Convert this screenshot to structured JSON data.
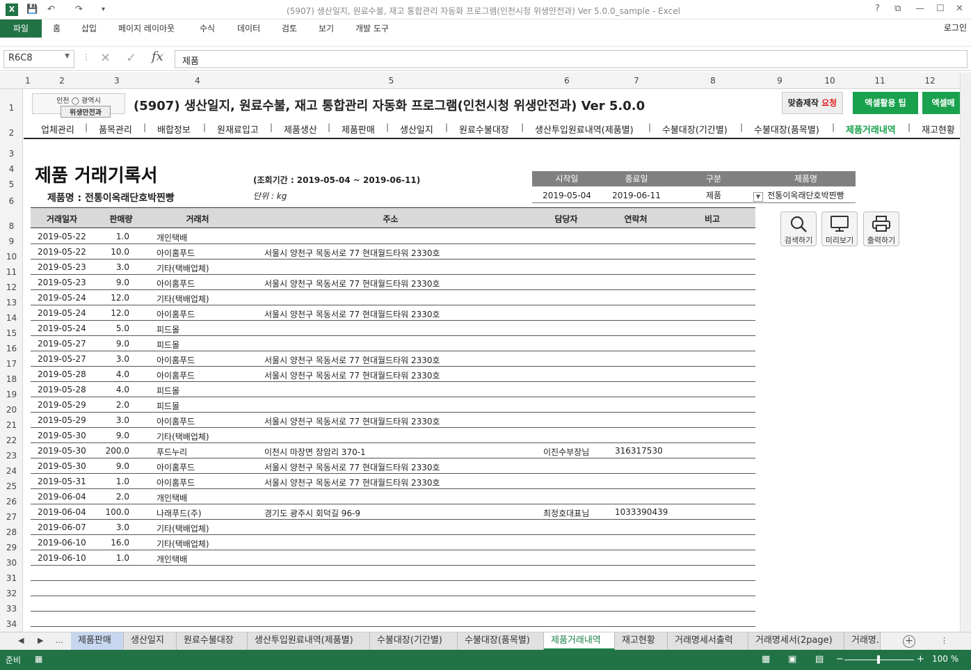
{
  "window": {
    "title": "(5907) 생산일지, 원료수불, 재고 통합관리 자동화 프로그램(인천시청 위생안전과) Ver 5.0.0_sample - Excel",
    "app_icon": "X",
    "controls": [
      "?",
      "⧉",
      "—",
      "☐",
      "✕"
    ]
  },
  "ribbon": {
    "tabs": [
      "파일",
      "홈",
      "삽입",
      "페이지 레이아웃",
      "수식",
      "데이터",
      "검토",
      "보기",
      "개발 도구"
    ],
    "login": "로그인"
  },
  "formula_bar": {
    "name_box": "R6C8",
    "fx": "fx",
    "value": "제품"
  },
  "columns": [
    "1",
    "2",
    "3",
    "4",
    "5",
    "6",
    "7",
    "8",
    "9",
    "10",
    "11",
    "12"
  ],
  "rows": [
    "1",
    "2",
    "3",
    "4",
    "5",
    "6",
    "",
    "8",
    "9",
    "10",
    "11",
    "12",
    "13",
    "14",
    "15",
    "16",
    "17",
    "18",
    "19",
    "20",
    "21",
    "22",
    "23",
    "24",
    "25",
    "26",
    "27",
    "28",
    "29",
    "30",
    "31",
    "32",
    "33",
    "34"
  ],
  "banner": {
    "logo_top": "인천 ◯ 광역시",
    "logo_sub": "위생안전과",
    "title": "(5907) 생산일지, 원료수불, 재고 통합관리 자동화 프로그램(인천시청 위생안전과) Ver 5.0.0",
    "request_btn_prefix": "맞춤제작",
    "request_btn_suffix": "요청",
    "tips_btn": "엑셀활용 팁",
    "extra_btn": "엑셀메"
  },
  "menu": [
    {
      "label": "업체관리"
    },
    {
      "label": "품목관리"
    },
    {
      "label": "배합정보"
    },
    {
      "label": "원재료입고"
    },
    {
      "label": "제품생산"
    },
    {
      "label": "제품판매"
    },
    {
      "label": "생산일지"
    },
    {
      "label": "원료수불대장"
    },
    {
      "label": "생산투입원료내역(제품별)"
    },
    {
      "label": "수불대장(기간별)"
    },
    {
      "label": "수불대장(품목별)"
    },
    {
      "label": "제품거래내역",
      "active": true
    },
    {
      "label": "재고현황"
    }
  ],
  "document": {
    "title": "제품 거래기록서",
    "product_line": "제품명 :  전통이옥래단호박찐빵",
    "period": "(조회기간 : 2019-05-04 ~ 2019-06-11)",
    "unit": "단위 : kg"
  },
  "filter": {
    "headers": [
      "시작일",
      "종료일",
      "구분",
      "제품명"
    ],
    "values": [
      "2019-05-04",
      "2019-06-11",
      "제품",
      "전통이옥래단호박찐빵"
    ]
  },
  "table": {
    "headers": [
      "거래일자",
      "판매량",
      "거래처",
      "주소",
      "담당자",
      "연락처",
      "비고"
    ],
    "rows": [
      [
        "2019-05-22",
        "1.0",
        "개인택배",
        "",
        "",
        "",
        ""
      ],
      [
        "2019-05-22",
        "10.0",
        "아이홈푸드",
        "서울시 양천구 목동서로 77 현대월드타워 2330호",
        "",
        "",
        ""
      ],
      [
        "2019-05-23",
        "3.0",
        "기타(택배업체)",
        "",
        "",
        "",
        ""
      ],
      [
        "2019-05-23",
        "9.0",
        "아이홈푸드",
        "서울시 양천구 목동서로 77 현대월드타워 2330호",
        "",
        "",
        ""
      ],
      [
        "2019-05-24",
        "12.0",
        "기타(택배업체)",
        "",
        "",
        "",
        ""
      ],
      [
        "2019-05-24",
        "12.0",
        "아이홈푸드",
        "서울시 양천구 목동서로 77 현대월드타워 2330호",
        "",
        "",
        ""
      ],
      [
        "2019-05-24",
        "5.0",
        "피드몰",
        "",
        "",
        "",
        ""
      ],
      [
        "2019-05-27",
        "9.0",
        "피드몰",
        "",
        "",
        "",
        ""
      ],
      [
        "2019-05-27",
        "3.0",
        "아이홈푸드",
        "서울시 양천구 목동서로 77 현대월드타워 2330호",
        "",
        "",
        ""
      ],
      [
        "2019-05-28",
        "4.0",
        "아이홈푸드",
        "서울시 양천구 목동서로 77 현대월드타워 2330호",
        "",
        "",
        ""
      ],
      [
        "2019-05-28",
        "4.0",
        "피드몰",
        "",
        "",
        "",
        ""
      ],
      [
        "2019-05-29",
        "2.0",
        "피드몰",
        "",
        "",
        "",
        ""
      ],
      [
        "2019-05-29",
        "3.0",
        "아이홈푸드",
        "서울시 양천구 목동서로 77 현대월드타워 2330호",
        "",
        "",
        ""
      ],
      [
        "2019-05-30",
        "9.0",
        "기타(택배업체)",
        "",
        "",
        "",
        ""
      ],
      [
        "2019-05-30",
        "200.0",
        "푸드누리",
        "이천시 마장면 장암리 370-1",
        "이진수부장님",
        "316317530",
        ""
      ],
      [
        "2019-05-30",
        "9.0",
        "아이홈푸드",
        "서울시 양천구 목동서로 77 현대월드타워 2330호",
        "",
        "",
        ""
      ],
      [
        "2019-05-31",
        "1.0",
        "아이홈푸드",
        "서울시 양천구 목동서로 77 현대월드타워 2330호",
        "",
        "",
        ""
      ],
      [
        "2019-06-04",
        "2.0",
        "개인택배",
        "",
        "",
        "",
        ""
      ],
      [
        "2019-06-04",
        "100.0",
        "나래푸드(주)",
        "경기도 광주시 회덕길 96-9",
        "최정호대표님",
        "1033390439",
        ""
      ],
      [
        "2019-06-07",
        "3.0",
        "기타(택배업체)",
        "",
        "",
        "",
        ""
      ],
      [
        "2019-06-10",
        "16.0",
        "기타(택배업체)",
        "",
        "",
        "",
        ""
      ],
      [
        "2019-06-10",
        "1.0",
        "개인택배",
        "",
        "",
        "",
        ""
      ],
      [
        "",
        "",
        "",
        "",
        "",
        "",
        ""
      ],
      [
        "",
        "",
        "",
        "",
        "",
        "",
        ""
      ],
      [
        "",
        "",
        "",
        "",
        "",
        "",
        ""
      ],
      [
        "",
        "",
        "",
        "",
        "",
        "",
        ""
      ]
    ]
  },
  "side_buttons": [
    {
      "label": "검색하기",
      "icon": "search-icon"
    },
    {
      "label": "미리보기",
      "icon": "monitor-icon"
    },
    {
      "label": "출력하기",
      "icon": "printer-icon"
    }
  ],
  "sheet_tabs": [
    {
      "label": "제품판매",
      "colored": true
    },
    {
      "label": "생산일지"
    },
    {
      "label": "원료수불대장"
    },
    {
      "label": "생산투입원료내역(제품별)"
    },
    {
      "label": "수불대장(기간별)"
    },
    {
      "label": "수불대장(품목별)"
    },
    {
      "label": "제품거래내역",
      "active": true
    },
    {
      "label": "재고현황"
    },
    {
      "label": "거래명세서출력"
    },
    {
      "label": "거래명세서(2page)"
    },
    {
      "label": "거래명..."
    }
  ],
  "status": {
    "ready": "준비",
    "zoom": "100 %"
  },
  "colors": {
    "excel_green": "#217346",
    "accent_green": "#1aa14e",
    "request_red": "#e02020"
  }
}
